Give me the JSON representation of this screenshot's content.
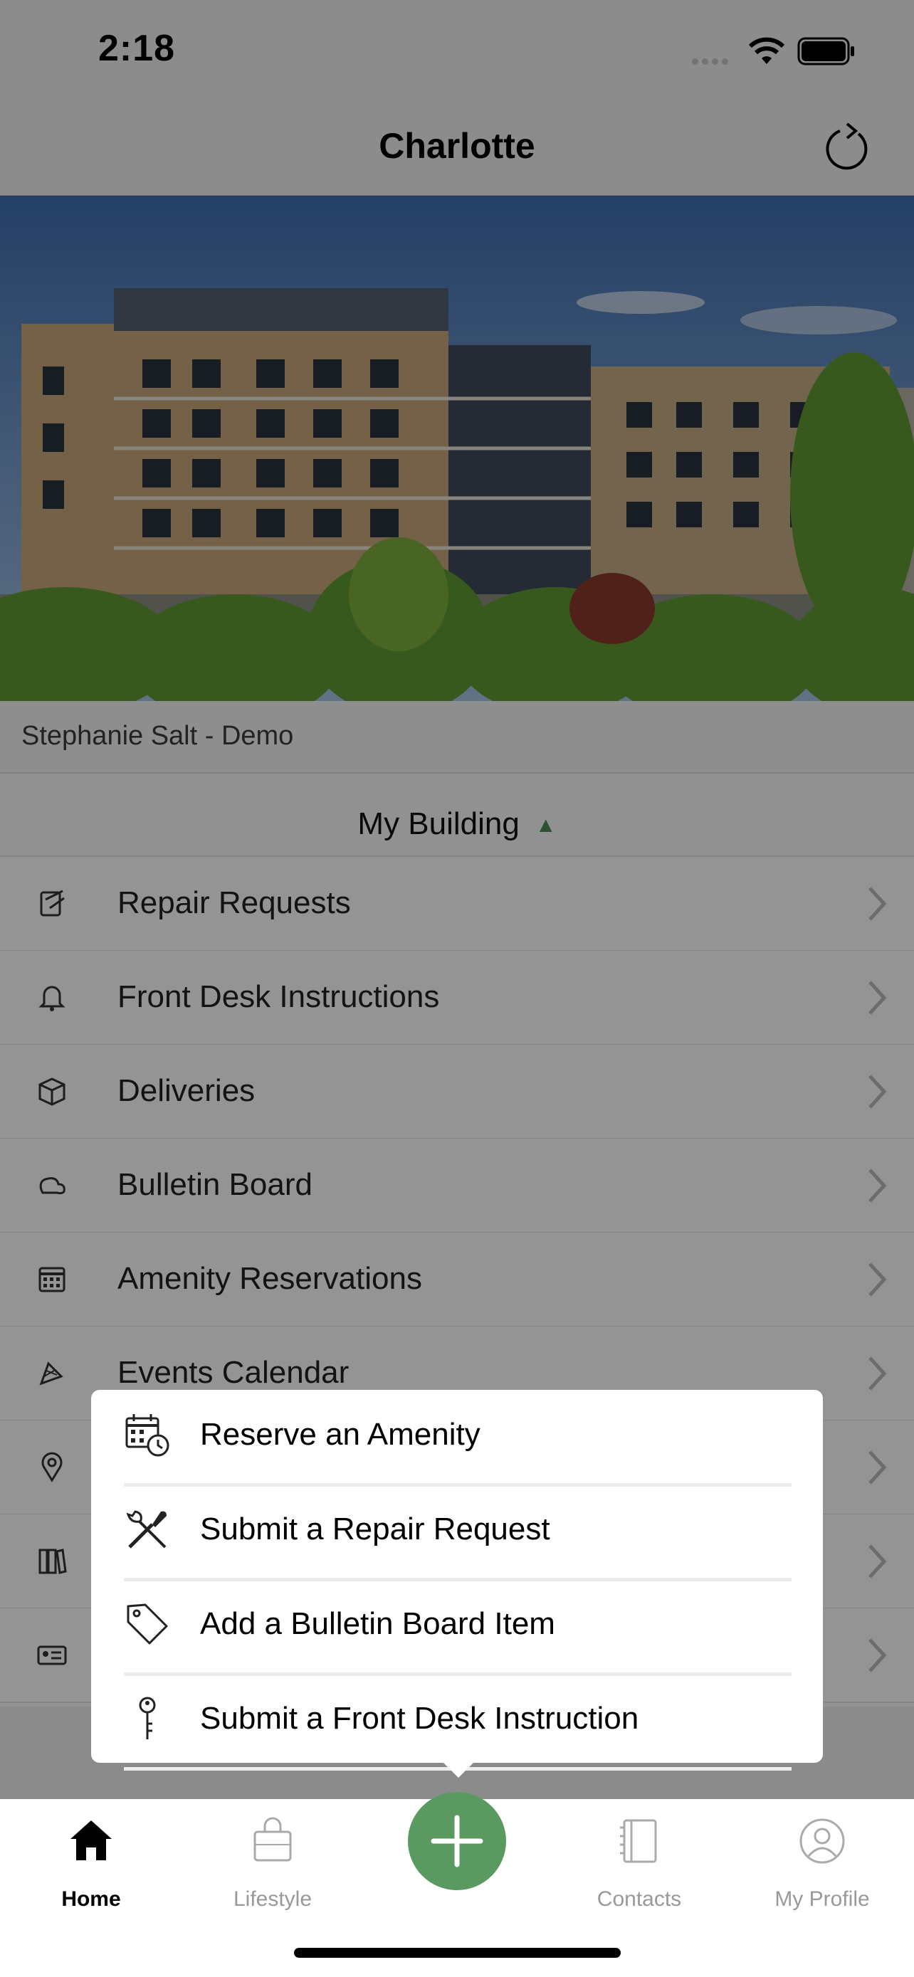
{
  "status_bar": {
    "time": "2:18"
  },
  "nav": {
    "title": "Charlotte",
    "refresh_icon": "refresh-icon"
  },
  "resident": {
    "name": "Stephanie Salt - Demo"
  },
  "section": {
    "title": "My Building",
    "toggle_icon": "triangle-up-icon"
  },
  "menu_items": [
    {
      "label": "Repair Requests",
      "icon": "repair-icon"
    },
    {
      "label": "Front Desk Instructions",
      "icon": "bell-icon"
    },
    {
      "label": "Deliveries",
      "icon": "box-icon"
    },
    {
      "label": "Bulletin Board",
      "icon": "chat-icon"
    },
    {
      "label": "Amenity Reservations",
      "icon": "calendar-icon"
    },
    {
      "label": "Events Calendar",
      "icon": "confetti-icon"
    },
    {
      "label": "",
      "icon": "location-icon"
    },
    {
      "label": "",
      "icon": "books-icon"
    },
    {
      "label": "",
      "icon": "id-card-icon"
    }
  ],
  "popup": {
    "items": [
      {
        "label": "Reserve an Amenity",
        "icon": "calendar-clock-icon"
      },
      {
        "label": "Submit a Repair Request",
        "icon": "tools-icon"
      },
      {
        "label": "Add a Bulletin Board Item",
        "icon": "tag-icon"
      },
      {
        "label": "Submit a Front Desk Instruction",
        "icon": "key-icon"
      }
    ]
  },
  "tabs": {
    "home": "Home",
    "lifestyle": "Lifestyle",
    "contacts": "Contacts",
    "profile": "My Profile",
    "fab_icon": "plus-icon"
  },
  "colors": {
    "accent": "#5a9a60",
    "overlay": "rgba(0,0,0,0.42)"
  }
}
